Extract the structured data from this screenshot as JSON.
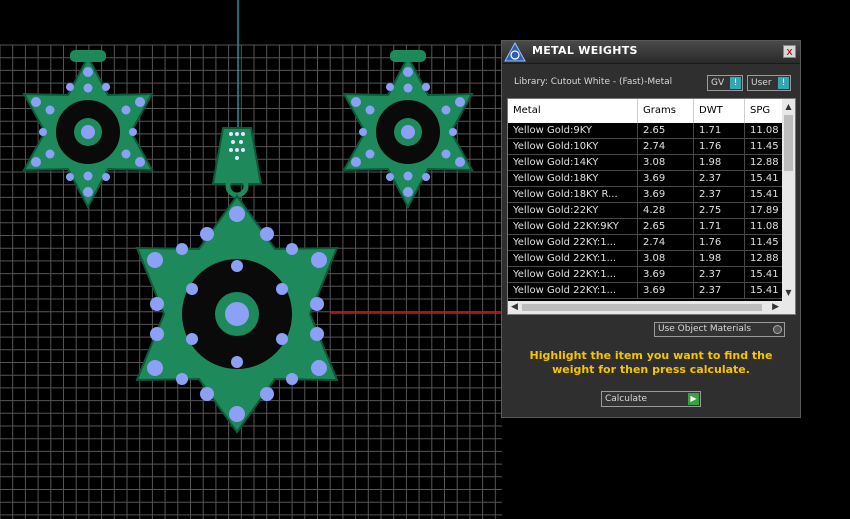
{
  "panel": {
    "title": "METAL WEIGHTS",
    "close": "x",
    "library": "Library: Cutout White - (Fast)-Metal",
    "gv_label": "GV",
    "gv_indicator": "!",
    "user_label": "User",
    "user_indicator": "!"
  },
  "table": {
    "headers": [
      "Metal",
      "Grams",
      "DWT",
      "SPG"
    ],
    "rows": [
      [
        "Yellow Gold:9KY",
        "2.65",
        "1.71",
        "11.08"
      ],
      [
        "Yellow Gold:10KY",
        "2.74",
        "1.76",
        "11.45"
      ],
      [
        "Yellow Gold:14KY",
        "3.08",
        "1.98",
        "12.88"
      ],
      [
        "Yellow Gold:18KY",
        "3.69",
        "2.37",
        "15.41"
      ],
      [
        "Yellow Gold:18KY R...",
        "3.69",
        "2.37",
        "15.41"
      ],
      [
        "Yellow Gold:22KY",
        "4.28",
        "2.75",
        "17.89"
      ],
      [
        "Yellow Gold 22KY:9KY",
        "2.65",
        "1.71",
        "11.08"
      ],
      [
        "Yellow Gold 22KY:1...",
        "2.74",
        "1.76",
        "11.45"
      ],
      [
        "Yellow Gold 22KY:1...",
        "3.08",
        "1.98",
        "12.88"
      ],
      [
        "Yellow Gold 22KY:1...",
        "3.69",
        "2.37",
        "15.41"
      ],
      [
        "Yellow Gold 22KY:1...",
        "3.69",
        "2.37",
        "15.41"
      ]
    ]
  },
  "use_object_materials": "Use Object Materials",
  "hint": "Highlight the item you want to find the weight for then press calculate.",
  "calculate": "Calculate",
  "colors": {
    "jewel_green": "#1e8a5c",
    "stone_blue": "#8ca0f6",
    "hint_yellow": "#f6c400",
    "indicator_teal": "#36a6b6"
  }
}
